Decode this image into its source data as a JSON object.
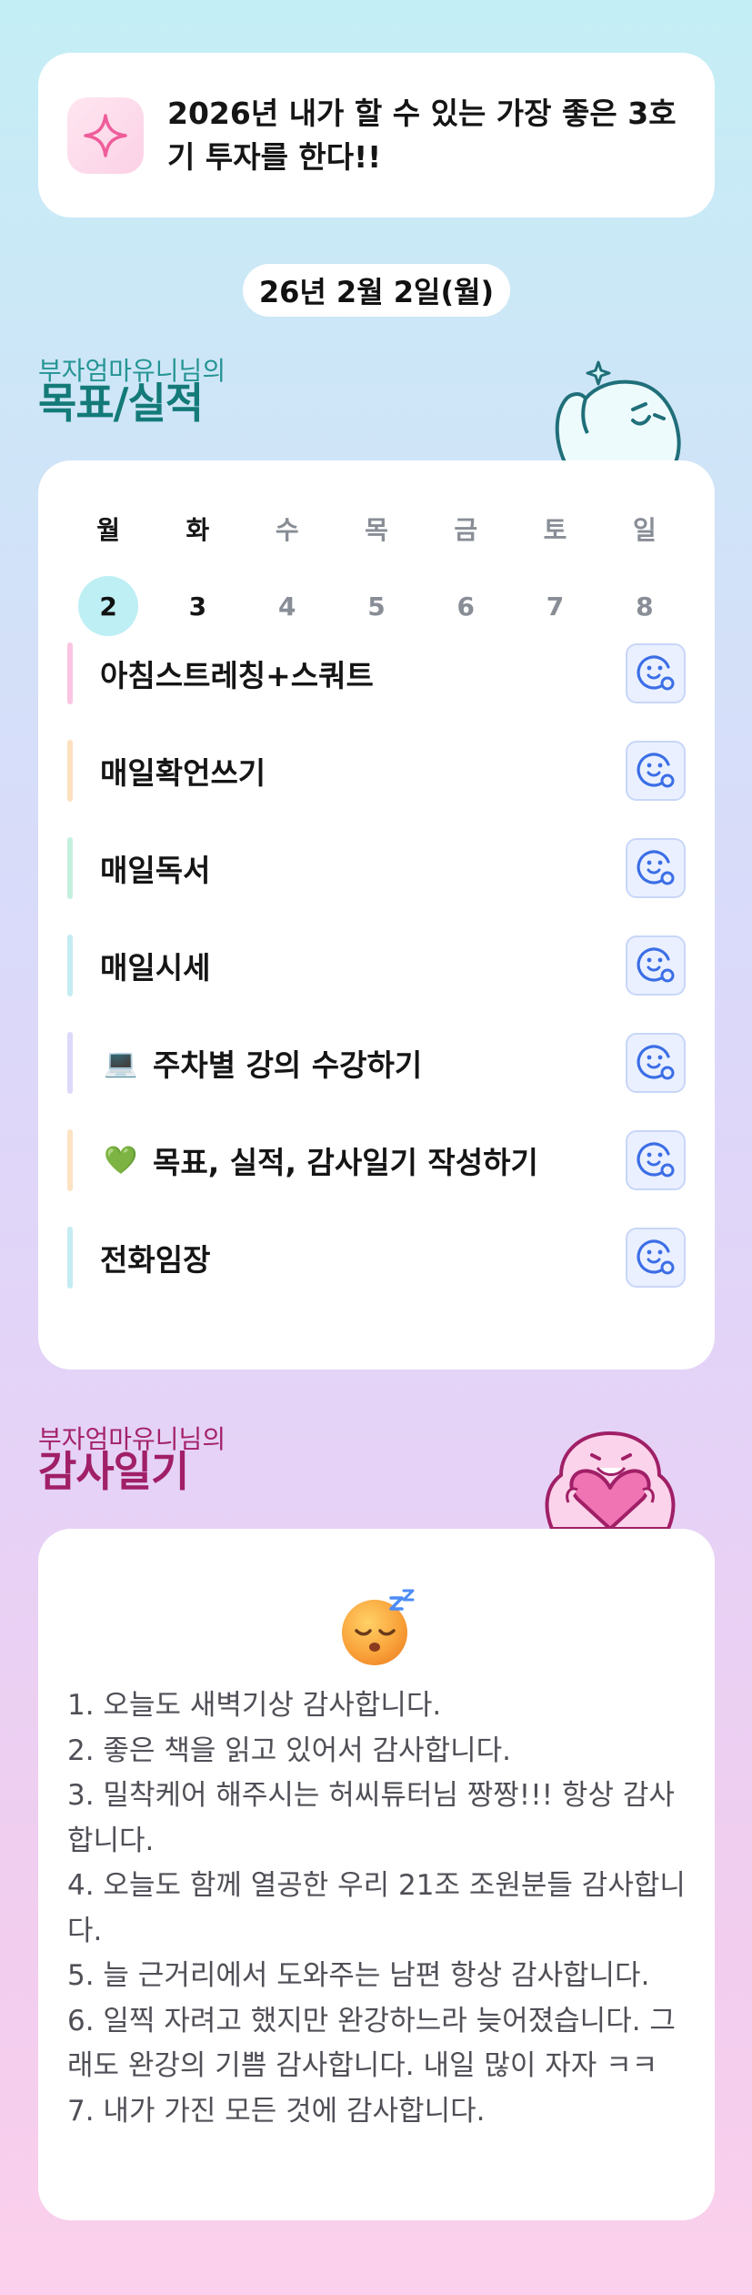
{
  "goal_banner": {
    "icon": "sparkle-icon",
    "text": "2026년 내가 할 수 있는 가장 좋은 3호기 투자를 한다!!"
  },
  "date_label": "26년 2월 2일(월)",
  "goals_section": {
    "subtitle": "부자엄마유니님의",
    "title": "목표/실적"
  },
  "week": [
    {
      "day": "월",
      "date": "2",
      "state": "today"
    },
    {
      "day": "화",
      "date": "3",
      "state": "active"
    },
    {
      "day": "수",
      "date": "4",
      "state": "future"
    },
    {
      "day": "목",
      "date": "5",
      "state": "future"
    },
    {
      "day": "금",
      "date": "6",
      "state": "future"
    },
    {
      "day": "토",
      "date": "7",
      "state": "future"
    },
    {
      "day": "일",
      "date": "8",
      "state": "future"
    }
  ],
  "tasks": [
    {
      "label": "아침스트레칭+스쿼트",
      "emoji": "",
      "bar_color": "#fbc5e3"
    },
    {
      "label": "매일확언쓰기",
      "emoji": "",
      "bar_color": "#fde0c0"
    },
    {
      "label": "매일독서",
      "emoji": "",
      "bar_color": "#c5f0de"
    },
    {
      "label": "매일시세",
      "emoji": "",
      "bar_color": "#c4ecf2"
    },
    {
      "label": "주차별 강의 수강하기",
      "emoji": "💻",
      "bar_color": "#dcd9fa"
    },
    {
      "label": "목표, 실적, 감사일기 작성하기",
      "emoji": "💚",
      "bar_color": "#fde3c4"
    },
    {
      "label": "전화임장",
      "emoji": "",
      "bar_color": "#c4ecf2"
    }
  ],
  "task_button_icon": "smiley-status-icon",
  "diary_section": {
    "subtitle": "부자엄마유니님의",
    "title": "감사일기",
    "mood_icon": "sleeping-face-icon",
    "body": "1. 오늘도 새벽기상 감사합니다.\n2. 좋은 책을 읽고 있어서 감사합니다.\n3. 밀착케어 해주시는 허씨튜터님 짱짱!!! 항상 감사합니다.\n4. 오늘도 함께 열공한 우리 21조 조원분들 감사합니다.\n5. 늘 근거리에서 도와주는 남편 항상 감사합니다.\n6. 일찍 자려고 했지만 완강하느라 늦어졌습니다. 그래도 완강의 기쁨 감사합니다. 내일 많이 자자 ㅋㅋ\n7. 내가 가진 모든 것에 감사합니다."
  },
  "colors": {
    "goals_accent": "#137a78",
    "diary_accent": "#a01f66",
    "today_circle": "#bdeff4",
    "task_button_bg": "#eaf0ff",
    "task_button_icon": "#3b6ee6"
  }
}
